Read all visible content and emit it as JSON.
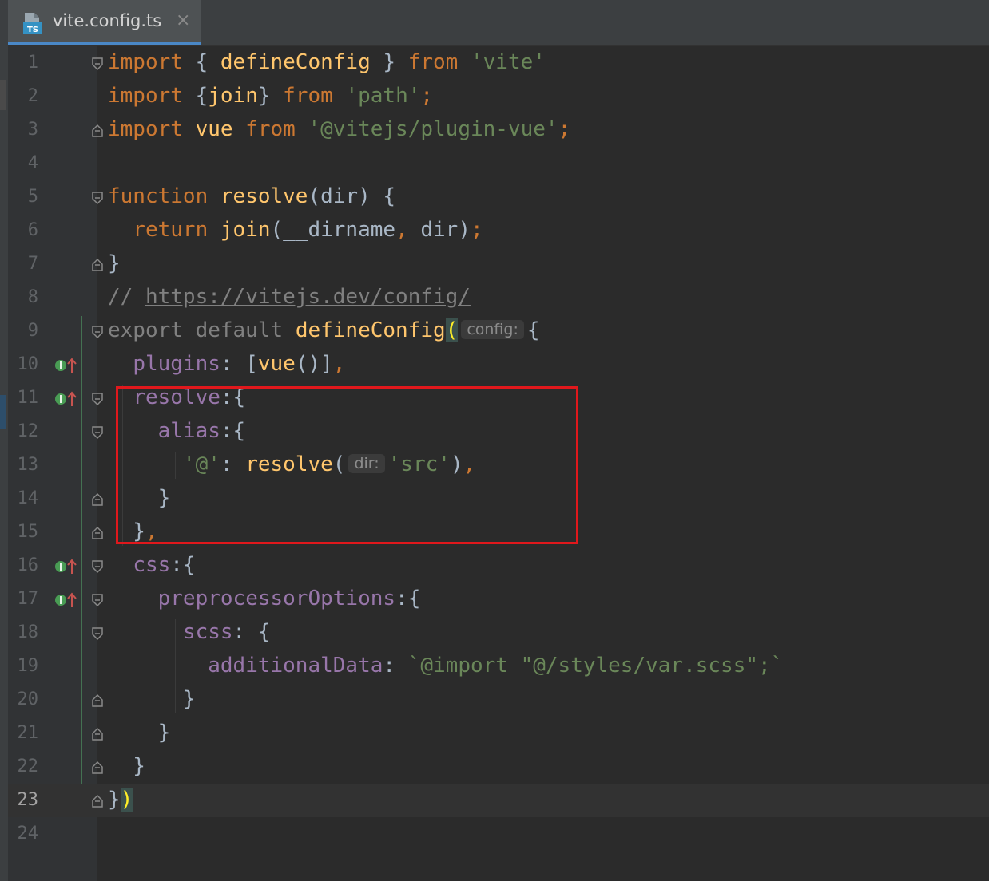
{
  "tab": {
    "title": "vite.config.ts",
    "icon": "ts-file-icon",
    "icon_label": "TS",
    "close": "×"
  },
  "colors": {
    "keyword": "#cc7832",
    "function": "#ffc66d",
    "string": "#6a8759",
    "property": "#9876aa",
    "comment": "#808080",
    "highlight": "#e0181c"
  },
  "lines": [
    {
      "num": "1",
      "tokens": [
        [
          "k",
          "import"
        ],
        [
          "t",
          " { "
        ],
        [
          "f",
          "defineConfig"
        ],
        [
          "t",
          " } "
        ],
        [
          "k",
          "from"
        ],
        [
          "t",
          " "
        ],
        [
          "s",
          "'vite'"
        ]
      ]
    },
    {
      "num": "2",
      "tokens": [
        [
          "k",
          "import"
        ],
        [
          "t",
          " {"
        ],
        [
          "f",
          "join"
        ],
        [
          "t",
          "} "
        ],
        [
          "k",
          "from"
        ],
        [
          "t",
          " "
        ],
        [
          "s",
          "'path'"
        ],
        [
          "k",
          ";"
        ]
      ]
    },
    {
      "num": "3",
      "tokens": [
        [
          "k",
          "import"
        ],
        [
          "t",
          " "
        ],
        [
          "f",
          "vue"
        ],
        [
          "t",
          " "
        ],
        [
          "k",
          "from"
        ],
        [
          "t",
          " "
        ],
        [
          "s",
          "'@vitejs/plugin-vue'"
        ],
        [
          "k",
          ";"
        ]
      ]
    },
    {
      "num": "4",
      "tokens": []
    },
    {
      "num": "5",
      "tokens": [
        [
          "k",
          "function"
        ],
        [
          "t",
          " "
        ],
        [
          "f",
          "resolve"
        ],
        [
          "t",
          "(dir) {"
        ]
      ]
    },
    {
      "num": "6",
      "tokens": [
        [
          "t",
          "  "
        ],
        [
          "k",
          "return"
        ],
        [
          "t",
          " "
        ],
        [
          "f",
          "join"
        ],
        [
          "t",
          "(__dirname"
        ],
        [
          "k",
          ","
        ],
        [
          "t",
          " dir)"
        ],
        [
          "k",
          ";"
        ]
      ]
    },
    {
      "num": "7",
      "tokens": [
        [
          "t",
          "}"
        ]
      ]
    },
    {
      "num": "8",
      "tokens": [
        [
          "c",
          "// "
        ],
        [
          "u",
          "https://vitejs.dev/config/"
        ]
      ]
    },
    {
      "num": "9",
      "tokens": [
        [
          "c",
          "export default "
        ],
        [
          "f",
          "defineConfig"
        ],
        [
          "hl",
          "("
        ],
        [
          "hint",
          "config:"
        ],
        [
          "t",
          "{"
        ]
      ]
    },
    {
      "num": "10",
      "tokens": [
        [
          "t",
          "  "
        ],
        [
          "p",
          "plugins"
        ],
        [
          "t",
          ": ["
        ],
        [
          "f",
          "vue"
        ],
        [
          "t",
          "()]"
        ],
        [
          "k",
          ","
        ]
      ]
    },
    {
      "num": "11",
      "tokens": [
        [
          "t",
          "  "
        ],
        [
          "p",
          "resolve"
        ],
        [
          "t",
          ":{"
        ]
      ]
    },
    {
      "num": "12",
      "tokens": [
        [
          "t",
          "    "
        ],
        [
          "p",
          "alias"
        ],
        [
          "t",
          ":{"
        ]
      ]
    },
    {
      "num": "13",
      "tokens": [
        [
          "t",
          "      "
        ],
        [
          "s",
          "'@'"
        ],
        [
          "t",
          ": "
        ],
        [
          "f",
          "resolve"
        ],
        [
          "t",
          "("
        ],
        [
          "hint",
          "dir:"
        ],
        [
          "s",
          "'src'"
        ],
        [
          "t",
          ")"
        ],
        [
          "k",
          ","
        ]
      ]
    },
    {
      "num": "14",
      "tokens": [
        [
          "t",
          "    }"
        ]
      ]
    },
    {
      "num": "15",
      "tokens": [
        [
          "t",
          "  }"
        ],
        [
          "k",
          ","
        ]
      ]
    },
    {
      "num": "16",
      "tokens": [
        [
          "t",
          "  "
        ],
        [
          "p",
          "css"
        ],
        [
          "t",
          ":{"
        ]
      ]
    },
    {
      "num": "17",
      "tokens": [
        [
          "t",
          "    "
        ],
        [
          "p",
          "preprocessorOptions"
        ],
        [
          "t",
          ":{"
        ]
      ]
    },
    {
      "num": "18",
      "tokens": [
        [
          "t",
          "      "
        ],
        [
          "p",
          "scss"
        ],
        [
          "t",
          ": {"
        ]
      ]
    },
    {
      "num": "19",
      "tokens": [
        [
          "t",
          "        "
        ],
        [
          "p",
          "additionalData"
        ],
        [
          "t",
          ": "
        ],
        [
          "s",
          "`@import \"@/styles/var.scss\";`"
        ]
      ]
    },
    {
      "num": "20",
      "tokens": [
        [
          "t",
          "      }"
        ]
      ]
    },
    {
      "num": "21",
      "tokens": [
        [
          "t",
          "    }"
        ]
      ]
    },
    {
      "num": "22",
      "tokens": [
        [
          "t",
          "  }"
        ]
      ]
    },
    {
      "num": "23",
      "tokens": [
        [
          "t",
          "}"
        ],
        [
          "hl",
          ")"
        ]
      ]
    },
    {
      "num": "24",
      "tokens": []
    }
  ],
  "implement_markers": [
    "10",
    "11",
    "16",
    "17"
  ],
  "fold_open": [
    "1",
    "5",
    "9",
    "11",
    "12",
    "16",
    "17",
    "18"
  ],
  "fold_close": [
    "3",
    "7",
    "14",
    "15",
    "20",
    "21",
    "22",
    "23"
  ],
  "current_line": "23"
}
